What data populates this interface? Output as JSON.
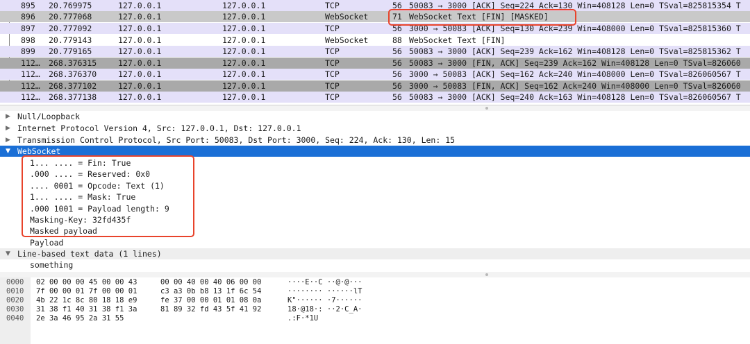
{
  "packet_list": {
    "rows": [
      {
        "no": "895",
        "time": "20.769975",
        "src": "127.0.0.1",
        "dst": "127.0.0.1",
        "proto": "TCP",
        "len": "56",
        "info": "50083 → 3000 [ACK] Seq=224 Ack=130 Win=408128 Len=0 TSval=825815354 T"
      },
      {
        "no": "896",
        "time": "20.777068",
        "src": "127.0.0.1",
        "dst": "127.0.0.1",
        "proto": "WebSocket",
        "len": "71",
        "info": "WebSocket Text [FIN] [MASKED]"
      },
      {
        "no": "897",
        "time": "20.777092",
        "src": "127.0.0.1",
        "dst": "127.0.0.1",
        "proto": "TCP",
        "len": "56",
        "info": "3000 → 50083 [ACK] Seq=130 Ack=239 Win=408000 Len=0 TSval=825815360 T"
      },
      {
        "no": "898",
        "time": "20.779143",
        "src": "127.0.0.1",
        "dst": "127.0.0.1",
        "proto": "WebSocket",
        "len": "88",
        "info": "WebSocket Text [FIN]"
      },
      {
        "no": "899",
        "time": "20.779165",
        "src": "127.0.0.1",
        "dst": "127.0.0.1",
        "proto": "TCP",
        "len": "56",
        "info": "50083 → 3000 [ACK] Seq=239 Ack=162 Win=408128 Len=0 TSval=825815362 T"
      },
      {
        "no": "112…",
        "time": "268.376315",
        "src": "127.0.0.1",
        "dst": "127.0.0.1",
        "proto": "TCP",
        "len": "56",
        "info": "50083 → 3000 [FIN, ACK] Seq=239 Ack=162 Win=408128 Len=0 TSval=826060"
      },
      {
        "no": "112…",
        "time": "268.376370",
        "src": "127.0.0.1",
        "dst": "127.0.0.1",
        "proto": "TCP",
        "len": "56",
        "info": "3000 → 50083 [ACK] Seq=162 Ack=240 Win=408000 Len=0 TSval=826060567 T"
      },
      {
        "no": "112…",
        "time": "268.377102",
        "src": "127.0.0.1",
        "dst": "127.0.0.1",
        "proto": "TCP",
        "len": "56",
        "info": "3000 → 50083 [FIN, ACK] Seq=162 Ack=240 Win=408000 Len=0 TSval=826060"
      },
      {
        "no": "112…",
        "time": "268.377138",
        "src": "127.0.0.1",
        "dst": "127.0.0.1",
        "proto": "TCP",
        "len": "56",
        "info": "50083 → 3000 [ACK] Seq=240 Ack=163 Win=408128 Len=0 TSval=826060567 T"
      }
    ]
  },
  "detail": {
    "null_loopback": "Null/Loopback",
    "ipv4": "Internet Protocol Version 4, Src: 127.0.0.1, Dst: 127.0.0.1",
    "tcp": "Transmission Control Protocol, Src Port: 50083, Dst Port: 3000, Seq: 224, Ack: 130, Len: 15",
    "websocket": "WebSocket",
    "ws_fields": [
      "1... .... = Fin: True",
      ".000 .... = Reserved: 0x0",
      ".... 0001 = Opcode: Text (1)",
      "1... .... = Mask: True",
      ".000 1001 = Payload length: 9",
      "Masking-Key: 32fd435f",
      "Masked payload",
      "Payload"
    ],
    "line_based": "Line-based text data (1 lines)",
    "line_text": "something"
  },
  "bytes": {
    "rows": [
      {
        "off": "0000",
        "hex1": "02 00 00 00 45 00 00 43",
        "hex2": "00 00 40 00 40 06 00 00",
        "ascii": "····E··C ··@·@···"
      },
      {
        "off": "0010",
        "hex1": "7f 00 00 01 7f 00 00 01",
        "hex2": "c3 a3 0b b8 13 1f 6c 54",
        "ascii": "········ ······lT"
      },
      {
        "off": "0020",
        "hex1": "4b 22 1c 8c 80 18 18 e9",
        "hex2": "fe 37 00 00 01 01 08 0a",
        "ascii": "K\"······ ·7······"
      },
      {
        "off": "0030",
        "hex1": "31 38 f1 40 31 38 f1 3a",
        "hex2": "81 89 32 fd 43 5f 41 92",
        "ascii": "18·@18·: ··2·C_A·"
      },
      {
        "off": "0040",
        "hex1": "2e 3a 46 95 2a 31 55",
        "hex2": "",
        "ascii": ".:F·*1U"
      }
    ]
  },
  "colors": {
    "tcp_row": "#e4e0f9",
    "fin_row": "#a9a9a9",
    "selected_tree": "#1a6fd6",
    "annotation_box": "#e8432b",
    "byte_highlight": "#bfdcf8"
  }
}
